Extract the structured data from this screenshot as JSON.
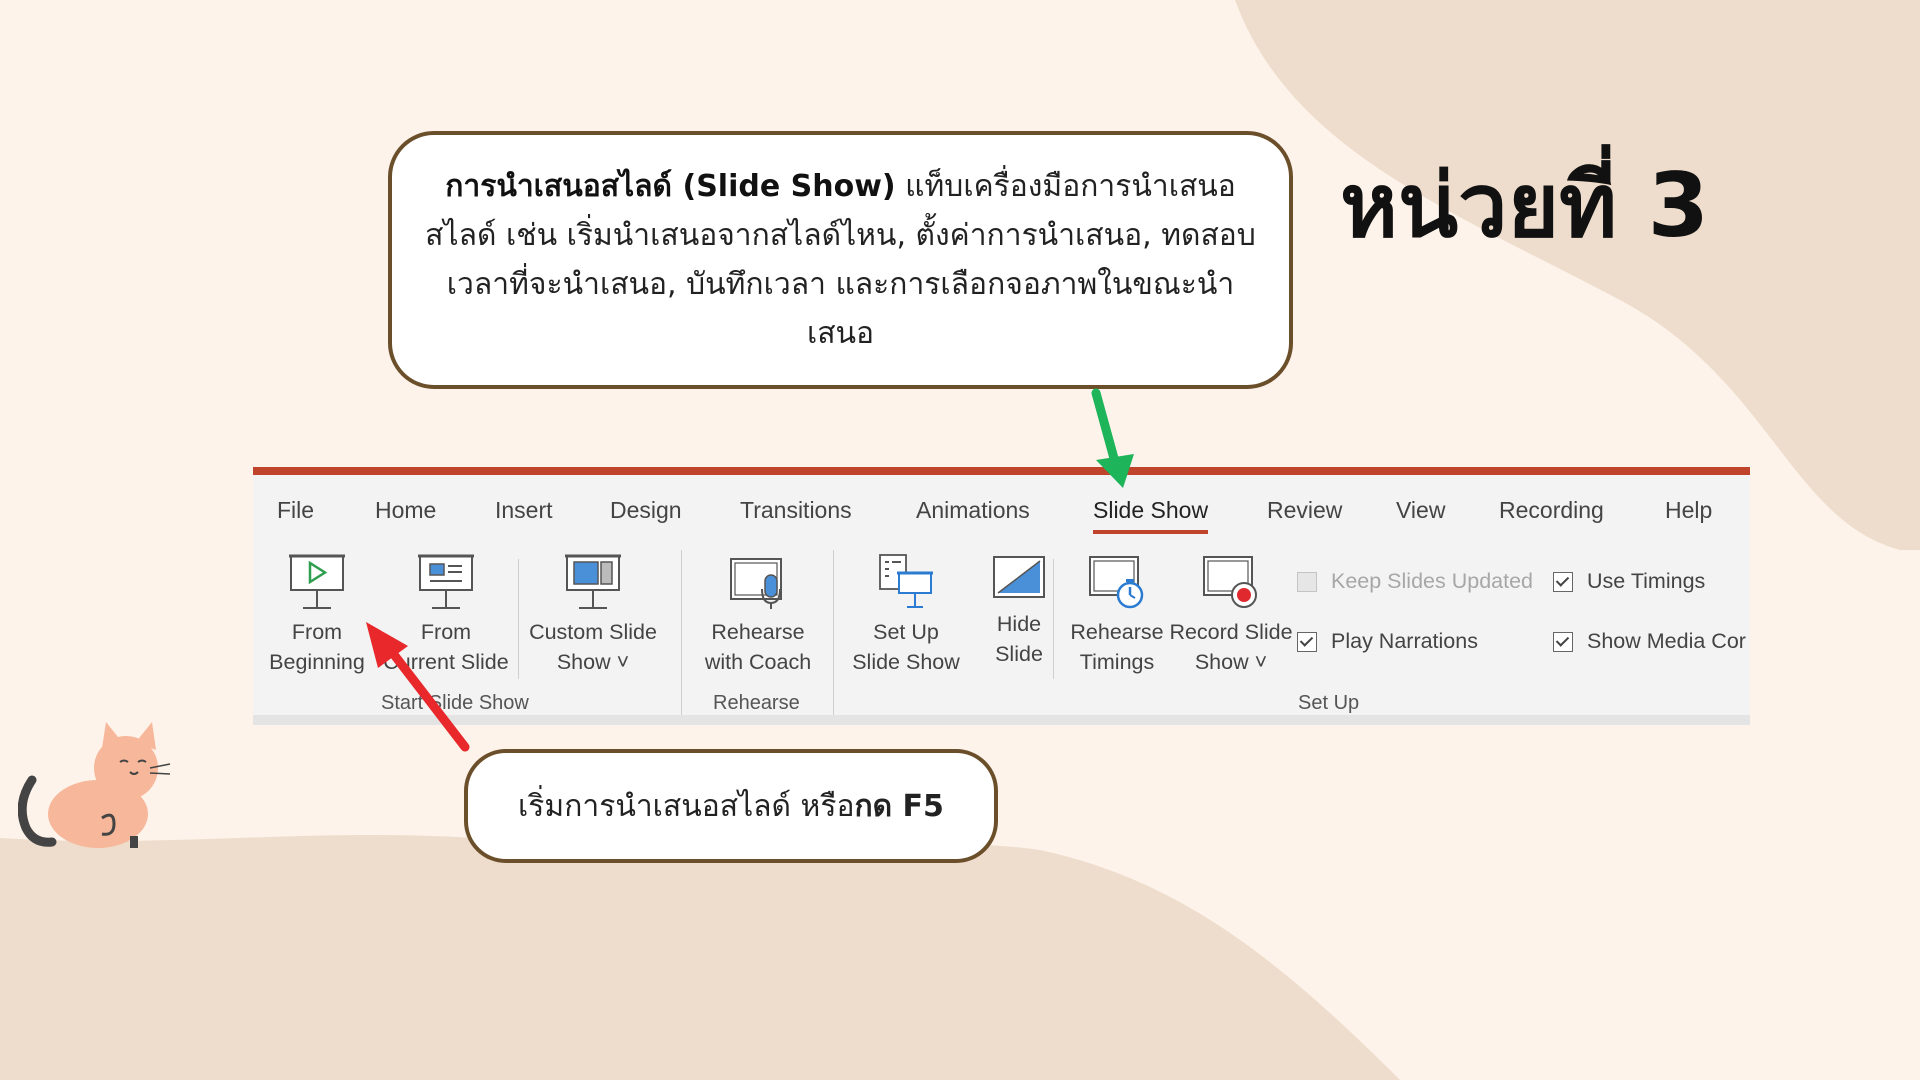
{
  "unit_title": "หน่วยที่ 3",
  "callout_top": {
    "bold": "การนำเสนอสไลด์ (Slide Show)",
    "text": " แท็บเครื่องมือการนำเสนอสไลด์ เช่น เริ่มนำเสนอจากสไลด์ไหน, ตั้งค่าการนำเสนอ, ทดสอบเวลาที่จะนำเสนอ, บันทึกเวลา และการเลือกจอภาพในขณะนำเสนอ"
  },
  "callout_bottom": {
    "text": "เริ่มการนำเสนอสไลด์ หรือ ",
    "bold": "กด F5"
  },
  "ribbon": {
    "tabs": [
      "File",
      "Home",
      "Insert",
      "Design",
      "Transitions",
      "Animations",
      "Slide Show",
      "Review",
      "View",
      "Recording",
      "Help"
    ],
    "active_tab": "Slide Show",
    "buttons": {
      "from_beginning": [
        "From",
        "Beginning"
      ],
      "from_current": [
        "From",
        "Current Slide"
      ],
      "custom_show": [
        "Custom Slide",
        "Show ˅"
      ],
      "rehearse_coach": [
        "Rehearse",
        "with Coach"
      ],
      "set_up": [
        "Set Up",
        "Slide Show"
      ],
      "hide_slide": [
        "Hide",
        "Slide"
      ],
      "rehearse_timings": [
        "Rehearse",
        "Timings"
      ],
      "record_show": [
        "Record Slide",
        "Show ˅"
      ]
    },
    "groups": {
      "start": "Start Slide Show",
      "rehearse": "Rehearse",
      "setup": "Set Up"
    },
    "checkboxes": {
      "keep_updated": {
        "label": "Keep Slides Updated",
        "checked": false,
        "disabled": true
      },
      "use_timings": {
        "label": "Use Timings",
        "checked": true
      },
      "play_narrations": {
        "label": "Play Narrations",
        "checked": true
      },
      "show_media": {
        "label": "Show Media Cor",
        "checked": true
      }
    }
  },
  "colors": {
    "background": "#fdf3ea",
    "blob": "#eeddcc",
    "ribbon_accent": "#c0432c",
    "callout_border": "#6b4f2a",
    "red_arrow": "#e8282b",
    "green_arrow": "#1db45a",
    "cat": "#f7b79a"
  }
}
